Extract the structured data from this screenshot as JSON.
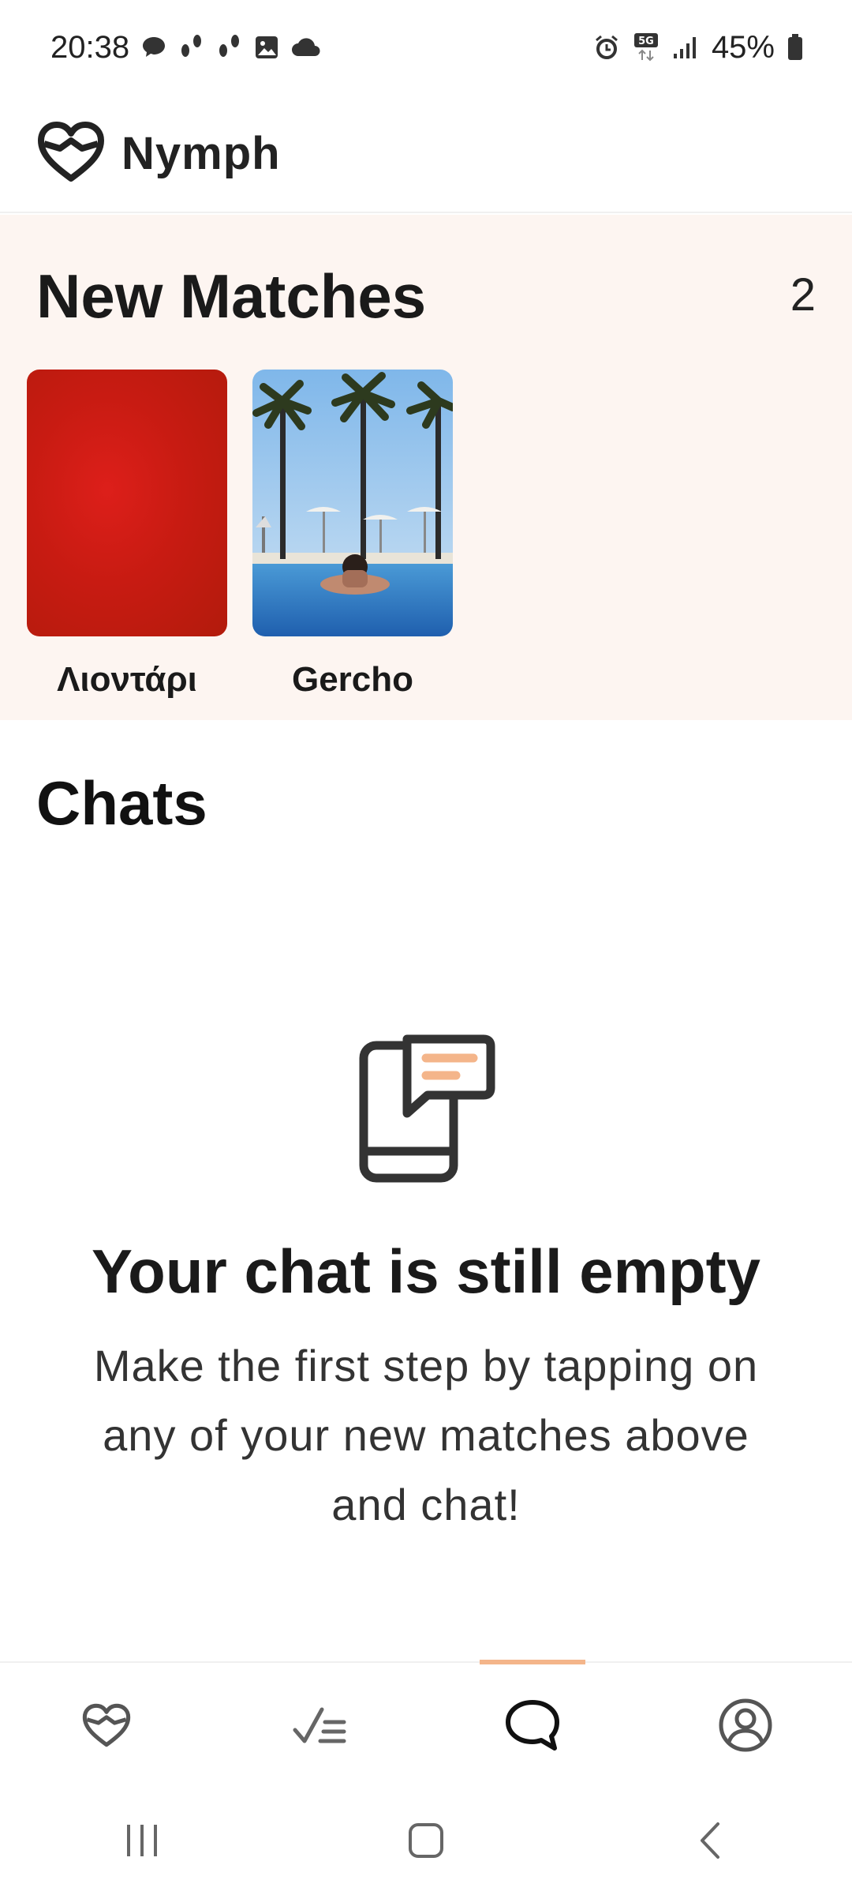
{
  "status_bar": {
    "time": "20:38",
    "battery": "45%",
    "icons_left": [
      "chat-bubble-icon",
      "steps-icon",
      "steps-icon",
      "image-icon",
      "cloud-icon"
    ],
    "icons_right": [
      "alarm-icon",
      "5g-icon",
      "signal-icon",
      "battery-icon"
    ]
  },
  "header": {
    "title": "Nymph",
    "logo_icon": "heart-logo-icon"
  },
  "new_matches": {
    "title": "New Matches",
    "count": "2",
    "items": [
      {
        "name": "Λιοντάρι"
      },
      {
        "name": "Gercho"
      }
    ]
  },
  "chats": {
    "title": "Chats",
    "empty_title": "Your chat is still empty",
    "empty_body": "Make the first step by tapping on any of your new matches above and chat!"
  },
  "bottom_nav": {
    "items": [
      "heart-icon",
      "checklist-icon",
      "chat-icon",
      "profile-icon"
    ],
    "active_item": "chat-icon"
  },
  "colors": {
    "accent": "#f4b58a",
    "matches_bg": "#fdf5f1"
  }
}
